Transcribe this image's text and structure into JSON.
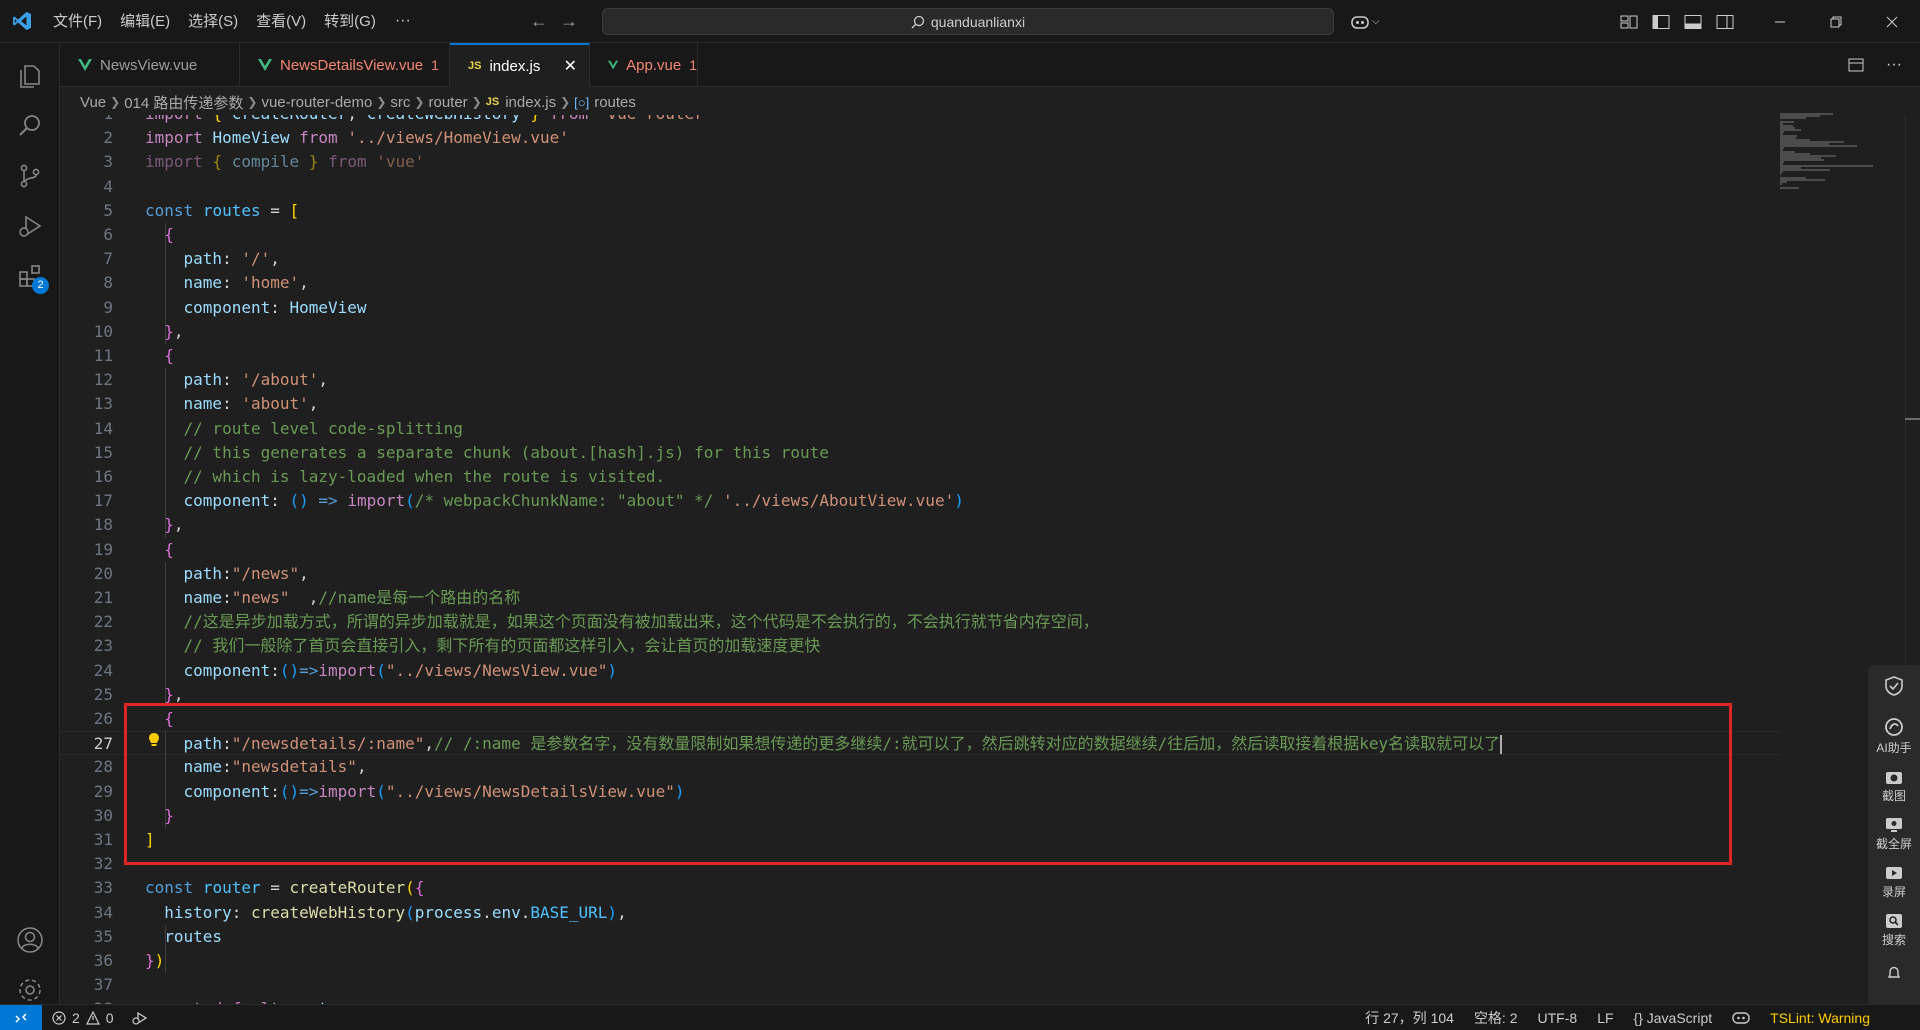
{
  "titlebar": {
    "menus": [
      "文件(F)",
      "编辑(E)",
      "选择(S)",
      "查看(V)",
      "转到(G)"
    ],
    "more": "···",
    "search_text": "quanduanlianxi"
  },
  "activitybar": {
    "extensions_badge": "2"
  },
  "tabs": [
    {
      "label": "NewsView.vue",
      "type": "vue",
      "error": false,
      "count": ""
    },
    {
      "label": "NewsDetailsView.vue",
      "type": "vue",
      "error": true,
      "count": "1"
    },
    {
      "label": "index.js",
      "type": "js",
      "active": true,
      "count": ""
    },
    {
      "label": "App.vue",
      "type": "vue",
      "error": true,
      "count": "1"
    }
  ],
  "breadcrumb": [
    "Vue",
    "014 路由传递参数",
    "vue-router-demo",
    "src",
    "router",
    "index.js",
    "routes"
  ],
  "code_lines": [
    {
      "n": "1",
      "tokens": [
        [
          "kw",
          "import"
        ],
        [
          "pl",
          " "
        ],
        [
          "b1",
          "{"
        ],
        [
          "pl",
          " "
        ],
        [
          "vr",
          "createRouter"
        ],
        [
          "pl",
          ", "
        ],
        [
          "vr",
          "createWebHistory"
        ],
        [
          "pl",
          " "
        ],
        [
          "b1",
          "}"
        ],
        [
          "pl",
          " "
        ],
        [
          "kw",
          "from"
        ],
        [
          "pl",
          " "
        ],
        [
          "str",
          "'vue-router'"
        ]
      ]
    },
    {
      "n": "2",
      "tokens": [
        [
          "kw",
          "import"
        ],
        [
          "pl",
          " "
        ],
        [
          "vr",
          "HomeView"
        ],
        [
          "pl",
          " "
        ],
        [
          "kw",
          "from"
        ],
        [
          "pl",
          " "
        ],
        [
          "str",
          "'../views/HomeView.vue'"
        ]
      ]
    },
    {
      "n": "3",
      "dim": true,
      "tokens": [
        [
          "kw",
          "import"
        ],
        [
          "pl",
          " "
        ],
        [
          "b1",
          "{"
        ],
        [
          "pl",
          " "
        ],
        [
          "vr",
          "compile"
        ],
        [
          "pl",
          " "
        ],
        [
          "b1",
          "}"
        ],
        [
          "pl",
          " "
        ],
        [
          "kw",
          "from"
        ],
        [
          "pl",
          " "
        ],
        [
          "str",
          "'vue'"
        ]
      ]
    },
    {
      "n": "4",
      "tokens": []
    },
    {
      "n": "5",
      "tokens": [
        [
          "st",
          "const"
        ],
        [
          "pl",
          " "
        ],
        [
          "cn",
          "routes"
        ],
        [
          "pl",
          " = "
        ],
        [
          "b1",
          "["
        ]
      ]
    },
    {
      "n": "6",
      "tokens": [
        [
          "pl",
          "  "
        ],
        [
          "b2",
          "{"
        ]
      ]
    },
    {
      "n": "7",
      "tokens": [
        [
          "pl",
          "    "
        ],
        [
          "vr",
          "path"
        ],
        [
          "pl",
          ": "
        ],
        [
          "str",
          "'/'"
        ],
        [
          "pl",
          ","
        ]
      ]
    },
    {
      "n": "8",
      "tokens": [
        [
          "pl",
          "    "
        ],
        [
          "vr",
          "name"
        ],
        [
          "pl",
          ": "
        ],
        [
          "str",
          "'home'"
        ],
        [
          "pl",
          ","
        ]
      ]
    },
    {
      "n": "9",
      "tokens": [
        [
          "pl",
          "    "
        ],
        [
          "vr",
          "component"
        ],
        [
          "pl",
          ": "
        ],
        [
          "vr",
          "HomeView"
        ]
      ]
    },
    {
      "n": "10",
      "tokens": [
        [
          "pl",
          "  "
        ],
        [
          "b2",
          "}"
        ],
        [
          "pl",
          ","
        ]
      ]
    },
    {
      "n": "11",
      "tokens": [
        [
          "pl",
          "  "
        ],
        [
          "b2",
          "{"
        ]
      ]
    },
    {
      "n": "12",
      "tokens": [
        [
          "pl",
          "    "
        ],
        [
          "vr",
          "path"
        ],
        [
          "pl",
          ": "
        ],
        [
          "str",
          "'/about'"
        ],
        [
          "pl",
          ","
        ]
      ]
    },
    {
      "n": "13",
      "tokens": [
        [
          "pl",
          "    "
        ],
        [
          "vr",
          "name"
        ],
        [
          "pl",
          ": "
        ],
        [
          "str",
          "'about'"
        ],
        [
          "pl",
          ","
        ]
      ]
    },
    {
      "n": "14",
      "tokens": [
        [
          "pl",
          "    "
        ],
        [
          "cm",
          "// route level code-splitting"
        ]
      ]
    },
    {
      "n": "15",
      "tokens": [
        [
          "pl",
          "    "
        ],
        [
          "cm",
          "// this generates a separate chunk (about.[hash].js) for this route"
        ]
      ]
    },
    {
      "n": "16",
      "tokens": [
        [
          "pl",
          "    "
        ],
        [
          "cm",
          "// which is lazy-loaded when the route is visited."
        ]
      ]
    },
    {
      "n": "17",
      "tokens": [
        [
          "pl",
          "    "
        ],
        [
          "vr",
          "component"
        ],
        [
          "pl",
          ": "
        ],
        [
          "b3",
          "()"
        ],
        [
          "pl",
          " "
        ],
        [
          "st",
          "=>"
        ],
        [
          "pl",
          " "
        ],
        [
          "kw",
          "import"
        ],
        [
          "b3",
          "("
        ],
        [
          "cm",
          "/* webpackChunkName: \"about\" */"
        ],
        [
          "pl",
          " "
        ],
        [
          "str",
          "'../views/AboutView.vue'"
        ],
        [
          "b3",
          ")"
        ]
      ]
    },
    {
      "n": "18",
      "tokens": [
        [
          "pl",
          "  "
        ],
        [
          "b2",
          "}"
        ],
        [
          "pl",
          ","
        ]
      ]
    },
    {
      "n": "19",
      "tokens": [
        [
          "pl",
          "  "
        ],
        [
          "b2",
          "{"
        ]
      ]
    },
    {
      "n": "20",
      "tokens": [
        [
          "pl",
          "    "
        ],
        [
          "vr",
          "path"
        ],
        [
          "pl",
          ":"
        ],
        [
          "str",
          "\"/news\""
        ],
        [
          "pl",
          ","
        ]
      ]
    },
    {
      "n": "21",
      "tokens": [
        [
          "pl",
          "    "
        ],
        [
          "vr",
          "name"
        ],
        [
          "pl",
          ":"
        ],
        [
          "str",
          "\"news\""
        ],
        [
          "pl",
          "  ,"
        ],
        [
          "cm",
          "//name是每一个路由的名称"
        ]
      ]
    },
    {
      "n": "22",
      "tokens": [
        [
          "pl",
          "    "
        ],
        [
          "cm",
          "//这是异步加载方式，所谓的异步加载就是，如果这个页面没有被加载出来，这个代码是不会执行的，不会执行就节省内存空间，"
        ]
      ]
    },
    {
      "n": "23",
      "tokens": [
        [
          "pl",
          "    "
        ],
        [
          "cm",
          "// 我们一般除了首页会直接引入，剩下所有的页面都这样引入，会让首页的加载速度更快"
        ]
      ]
    },
    {
      "n": "24",
      "tokens": [
        [
          "pl",
          "    "
        ],
        [
          "vr",
          "component"
        ],
        [
          "pl",
          ":"
        ],
        [
          "b3",
          "()"
        ],
        [
          "st",
          "=>"
        ],
        [
          "kw",
          "import"
        ],
        [
          "b3",
          "("
        ],
        [
          "str",
          "\"../views/NewsView.vue\""
        ],
        [
          "b3",
          ")"
        ]
      ]
    },
    {
      "n": "25",
      "tokens": [
        [
          "pl",
          "  "
        ],
        [
          "b2",
          "}"
        ],
        [
          "pl",
          ","
        ]
      ]
    },
    {
      "n": "26",
      "tokens": [
        [
          "pl",
          "  "
        ],
        [
          "b2",
          "{"
        ]
      ]
    },
    {
      "n": "27",
      "current": true,
      "tokens": [
        [
          "pl",
          "    "
        ],
        [
          "vr",
          "path"
        ],
        [
          "pl",
          ":"
        ],
        [
          "str",
          "\"/newsdetails/:name\""
        ],
        [
          "pl",
          ","
        ],
        [
          "cm",
          "// /:name 是参数名字，没有数量限制如果想传递的更多继续/:就可以了，然后跳转对应的数据继续/往后加，然后读取接着根据key名读取就可以了"
        ]
      ]
    },
    {
      "n": "28",
      "tokens": [
        [
          "pl",
          "    "
        ],
        [
          "vr",
          "name"
        ],
        [
          "pl",
          ":"
        ],
        [
          "str",
          "\"newsdetails\""
        ],
        [
          "pl",
          ","
        ]
      ]
    },
    {
      "n": "29",
      "tokens": [
        [
          "pl",
          "    "
        ],
        [
          "vr",
          "component"
        ],
        [
          "pl",
          ":"
        ],
        [
          "b3",
          "()"
        ],
        [
          "st",
          "=>"
        ],
        [
          "kw",
          "import"
        ],
        [
          "b3",
          "("
        ],
        [
          "str",
          "\"../views/NewsDetailsView.vue\""
        ],
        [
          "b3",
          ")"
        ]
      ]
    },
    {
      "n": "30",
      "tokens": [
        [
          "pl",
          "  "
        ],
        [
          "b2",
          "}"
        ]
      ]
    },
    {
      "n": "31",
      "tokens": [
        [
          "b1",
          "]"
        ]
      ]
    },
    {
      "n": "32",
      "tokens": []
    },
    {
      "n": "33",
      "tokens": [
        [
          "st",
          "const"
        ],
        [
          "pl",
          " "
        ],
        [
          "cn",
          "router"
        ],
        [
          "pl",
          " = "
        ],
        [
          "fn",
          "createRouter"
        ],
        [
          "b1",
          "("
        ],
        [
          "b2",
          "{"
        ]
      ]
    },
    {
      "n": "34",
      "tokens": [
        [
          "pl",
          "  "
        ],
        [
          "vr",
          "history"
        ],
        [
          "pl",
          ": "
        ],
        [
          "fn",
          "createWebHistory"
        ],
        [
          "b3",
          "("
        ],
        [
          "vr",
          "process"
        ],
        [
          "pl",
          "."
        ],
        [
          "vr",
          "env"
        ],
        [
          "pl",
          "."
        ],
        [
          "cn",
          "BASE_URL"
        ],
        [
          "b3",
          ")"
        ],
        [
          "pl",
          ","
        ]
      ]
    },
    {
      "n": "35",
      "tokens": [
        [
          "pl",
          "  "
        ],
        [
          "vr",
          "routes"
        ]
      ]
    },
    {
      "n": "36",
      "tokens": [
        [
          "b2",
          "}"
        ],
        [
          "b1",
          ")"
        ]
      ]
    },
    {
      "n": "37",
      "tokens": []
    },
    {
      "n": "38",
      "tokens": [
        [
          "kw",
          "export"
        ],
        [
          "pl",
          " "
        ],
        [
          "kw",
          "default"
        ],
        [
          "pl",
          " "
        ],
        [
          "vr",
          "router"
        ]
      ]
    }
  ],
  "sidetools": [
    {
      "label": "",
      "icon": "shield-check-icon"
    },
    {
      "label": "AI助手",
      "icon": "ai-assistant-icon"
    },
    {
      "label": "截图",
      "icon": "camera-icon"
    },
    {
      "label": "截全屏",
      "icon": "fullscreen-capture-icon"
    },
    {
      "label": "录屏",
      "icon": "record-icon"
    },
    {
      "label": "搜索",
      "icon": "search-icon"
    }
  ],
  "statusbar": {
    "errors": "2",
    "warnings": "0",
    "position": "行 27，列 104",
    "spaces": "空格: 2",
    "encoding": "UTF-8",
    "eol": "LF",
    "language": "{} JavaScript",
    "tslint": "TSLint: Warning"
  },
  "colors": {
    "accent": "#0078d4",
    "highlight_box": "#e02525",
    "editor_bg": "#1f1f1f"
  }
}
